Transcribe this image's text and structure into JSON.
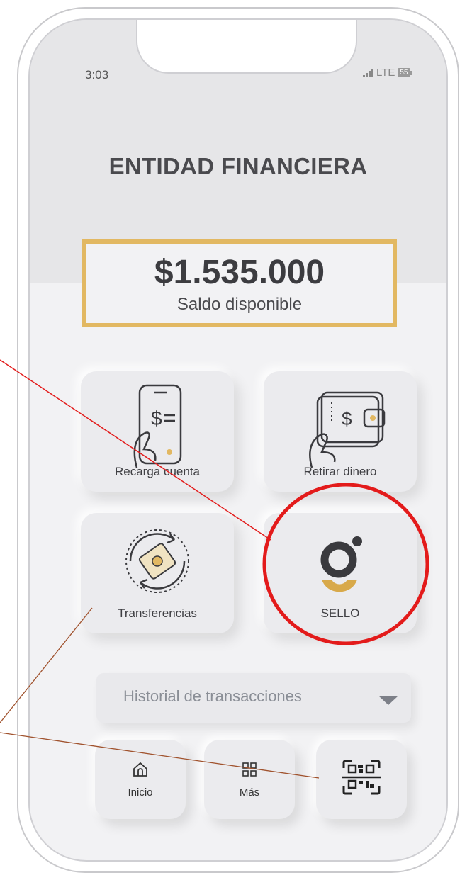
{
  "status_bar": {
    "time": "3:03",
    "network": "LTE",
    "battery": "55"
  },
  "app": {
    "title": "ENTIDAD FINANCIERA"
  },
  "balance": {
    "amount": "$1.535.000",
    "label": "Saldo disponible"
  },
  "actions": [
    {
      "label": "Recarga cuenta",
      "icon": "phone-payment-icon"
    },
    {
      "label": "Retirar dinero",
      "icon": "wallet-withdraw-icon"
    },
    {
      "label": "Transferencias",
      "icon": "transfer-cycle-icon"
    },
    {
      "label": "SELLO",
      "icon": "sello-logo-icon"
    }
  ],
  "history": {
    "label": "Historial de transacciones"
  },
  "bottom_nav": [
    {
      "label": "Inicio",
      "icon": "home-icon"
    },
    {
      "label": "Más",
      "icon": "grid-icon"
    },
    {
      "label": "",
      "icon": "qr-code-icon"
    }
  ],
  "colors": {
    "accent_gold": "#e2b862",
    "highlight_red": "#e31b1b",
    "annotation_line": "#a0522d"
  }
}
